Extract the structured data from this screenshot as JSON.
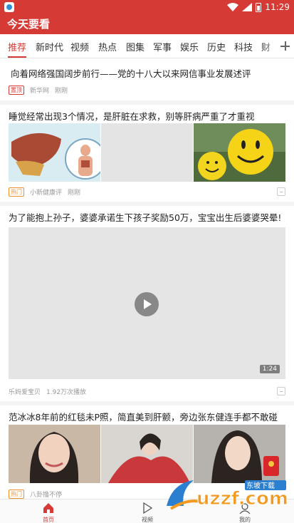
{
  "status": {
    "time": "11:29"
  },
  "app": {
    "title": "今天要看"
  },
  "tabs": [
    "推荐",
    "新时代",
    "视频",
    "热点",
    "图集",
    "军事",
    "娱乐",
    "历史",
    "科技",
    "财"
  ],
  "feed": [
    {
      "title": "向着网络强国阔步前行——党的十八大以来网信事业发展述评",
      "badge": "置顶",
      "source": "新华网",
      "time": "刚刚"
    },
    {
      "title": "睡觉经常出现3个情况，是肝脏在求救，别等肝病严重了才重视",
      "badge": "热门",
      "source": "小新健康评",
      "time": "刚刚"
    },
    {
      "title": "为了能抱上孙子，婆婆承诺生下孩子奖励50万，宝宝出生后婆婆哭晕!",
      "duration": "1:24",
      "source": "乐妈爱宝贝",
      "views": "1.92万次播放"
    },
    {
      "title": "范冰冰8年前的红毯未P照，简直美到肝颤，旁边张东健连手都不敢碰",
      "badge": "热门",
      "source": "八卦撸不停"
    }
  ],
  "bottom_nav": [
    {
      "label": "首页",
      "icon": "home-icon"
    },
    {
      "label": "视频",
      "icon": "play-icon"
    },
    {
      "label": "我的",
      "icon": "user-icon"
    }
  ],
  "watermark": {
    "text": "uzzf.com",
    "tag": "东坡下载"
  },
  "colors": {
    "brand": "#d63a35",
    "badge_hot": "#f0902a"
  }
}
